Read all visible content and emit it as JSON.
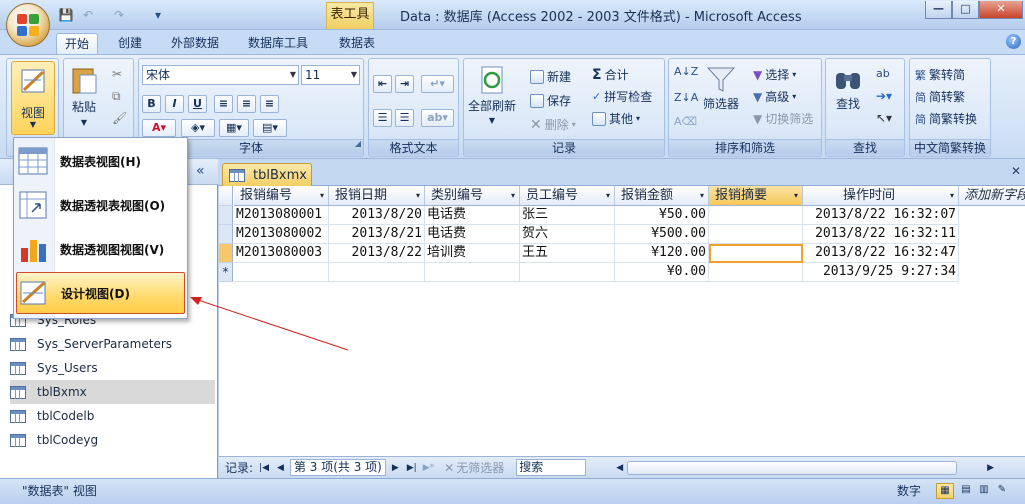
{
  "window": {
    "title": "Data : 数据库 (Access 2002 - 2003 文件格式) - Microsoft Access",
    "contextual_tab": "表工具",
    "minimize": "—",
    "maximize": "□",
    "close": "✕"
  },
  "tabs": [
    "开始",
    "创建",
    "外部数据",
    "数据库工具",
    "数据表"
  ],
  "help": "?",
  "ribbon": {
    "view_label": "视图",
    "paste_label": "粘贴",
    "font_group": "字体",
    "font_name": "宋体",
    "font_size": "11",
    "bold": "B",
    "italic": "I",
    "underline": "U",
    "text_format_group": "格式文本",
    "records_group": "记录",
    "refresh_all": "全部刷新",
    "new": "新建",
    "save": "保存",
    "delete": "删除",
    "totals": "合计",
    "spelling": "拼写检查",
    "more": "其他",
    "sort_filter_group": "排序和筛选",
    "filter": "筛选器",
    "selection": "选择",
    "advanced": "高级",
    "toggle_filter": "切换筛选",
    "find_group": "查找",
    "find": "查找",
    "chinese_group": "中文简繁转换",
    "to_simplified": "繁转简",
    "to_traditional": "简转繁",
    "convert": "简繁转换"
  },
  "view_menu": [
    {
      "label": "数据表视图(H)"
    },
    {
      "label": "数据透视表视图(O)"
    },
    {
      "label": "数据透视图视图(V)"
    },
    {
      "label": "设计视图(D)"
    }
  ],
  "nav": {
    "collapse": "«",
    "items": [
      "Sys_Roles",
      "Sys_ServerParameters",
      "Sys_Users",
      "tblBxmx",
      "tblCodelb",
      "tblCodeyg"
    ],
    "selected": "tblBxmx"
  },
  "document": {
    "tab": "tblBxmx",
    "close": "✕",
    "columns": [
      "报销编号",
      "报销日期",
      "类别编号",
      "员工编号",
      "报销金额",
      "报销摘要",
      "操作时间",
      "添加新字段"
    ],
    "rows": [
      [
        "M2013080001",
        "2013/8/20",
        "电话费",
        "张三",
        "¥50.00",
        "",
        "2013/8/22 16:32:07"
      ],
      [
        "M2013080002",
        "2013/8/21",
        "电话费",
        "贺六",
        "¥500.00",
        "",
        "2013/8/22 16:32:11"
      ],
      [
        "M2013080003",
        "2013/8/22",
        "培训费",
        "王五",
        "¥120.00",
        "",
        "2013/8/22 16:32:47"
      ],
      [
        "",
        "",
        "",
        "",
        "¥0.00",
        "",
        "2013/9/25 9:27:34"
      ]
    ],
    "new_row_marker": "*"
  },
  "record_nav": {
    "label": "记录:",
    "position": "第 3 项(共 3 项)",
    "no_filter": "无筛选器",
    "search": "搜索"
  },
  "status": {
    "left": "\"数据表\" 视图",
    "right": "数字"
  }
}
